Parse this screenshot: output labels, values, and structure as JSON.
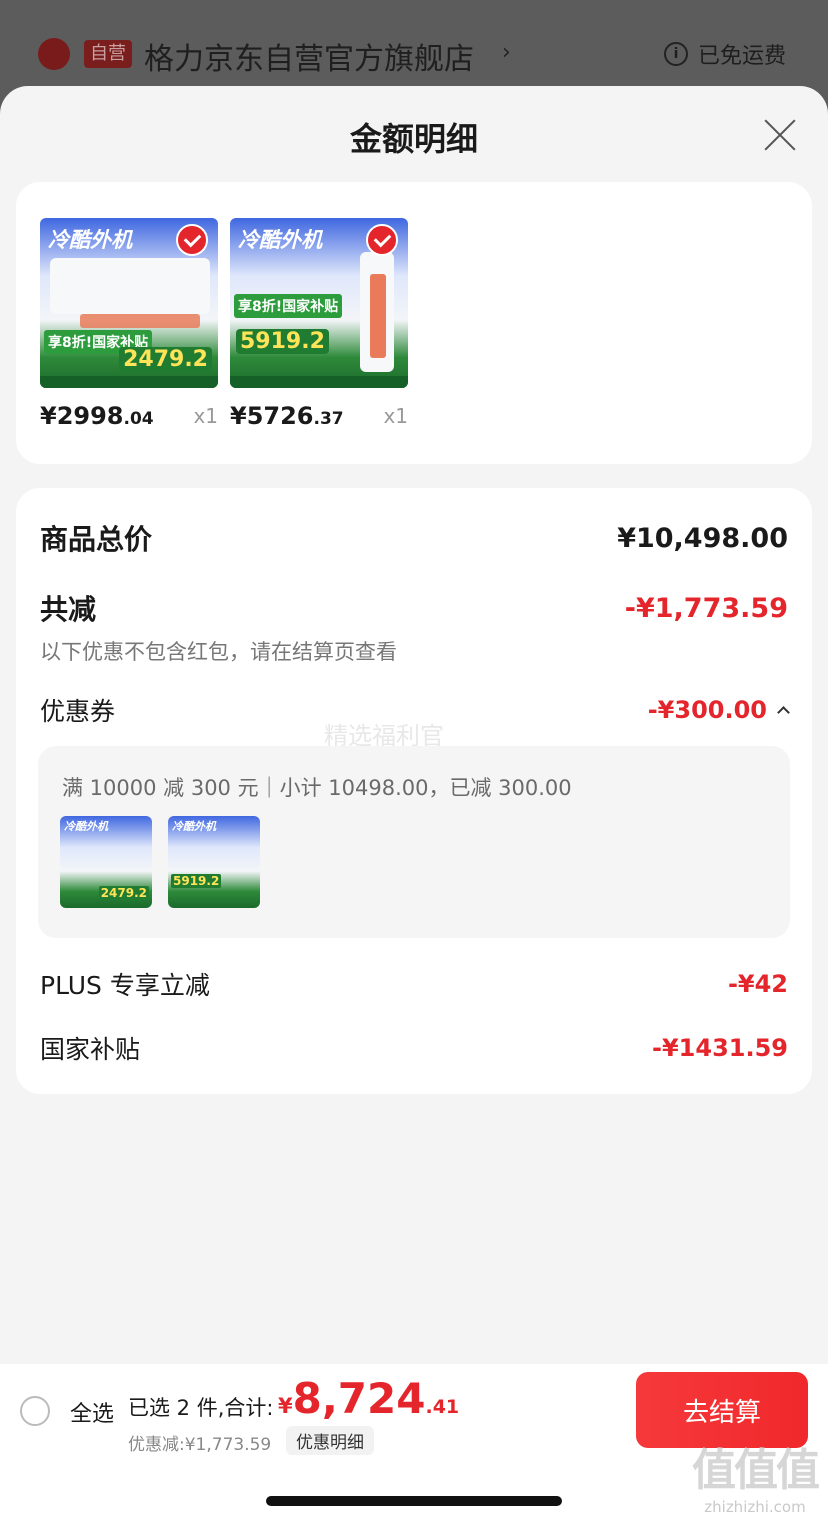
{
  "store": {
    "badge": "自营",
    "name": "格力京东自营官方旗舰店",
    "shipping": "已免运费"
  },
  "sheet": {
    "title": "金额明细"
  },
  "products": [
    {
      "headline": "冷酷外机",
      "promo": "享8折!国家补贴",
      "promo_price": "2479.2",
      "price_main": "¥2998",
      "price_dec": ".04",
      "qty": "x1"
    },
    {
      "headline": "冷酷外机",
      "promo": "享8折!国家补贴",
      "promo_price": "5919.2",
      "price_main": "¥5726",
      "price_dec": ".37",
      "qty": "x1"
    }
  ],
  "summary": {
    "total_label": "商品总价",
    "total_value": "¥10,498.00",
    "reduce_label": "共减",
    "reduce_value": "-¥1,773.59",
    "note": "以下优惠不包含红包，请在结算页查看",
    "coupon_label": "优惠券",
    "coupon_value": "-¥300.00",
    "watermark": "精选福利官",
    "coupon_detail": "满 10000 减 300 元｜小计 10498.00，已减 300.00",
    "plus_label": "PLUS 专享立减",
    "plus_value": "-¥42",
    "subsidy_label": "国家补贴",
    "subsidy_value": "-¥1431.59"
  },
  "bottom": {
    "select_all": "全选",
    "selected": "已选 2 件,合计:",
    "currency": "¥",
    "total_big": "8,724",
    "total_small": ".41",
    "discount": "优惠减:¥1,773.59",
    "detail_chip": "优惠明细",
    "checkout": "去结算"
  },
  "watermark_corner": {
    "big": "值值值",
    "small": "zhizhizhi.com"
  },
  "colors": {
    "accent": "#e4252b",
    "sheet_bg": "#f4f4f4"
  }
}
